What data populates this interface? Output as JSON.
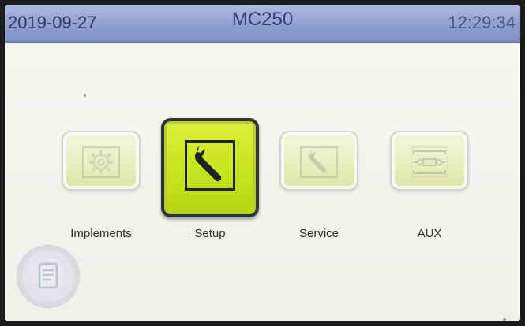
{
  "status_bar": {
    "date": "2019-09-27",
    "title": "MC250",
    "time": "12:29:34"
  },
  "menu": {
    "items": [
      {
        "label": "Implements",
        "icon": "gear-icon",
        "state": "disabled"
      },
      {
        "label": "Setup",
        "icon": "wrench-icon",
        "state": "selected"
      },
      {
        "label": "Service",
        "icon": "wrench-icon",
        "state": "disabled"
      },
      {
        "label": "AUX",
        "icon": "valve-schematic-icon",
        "state": "disabled"
      }
    ]
  },
  "back_button": {
    "icon": "document-icon"
  },
  "colors": {
    "status_bar": "#8f9fcf",
    "selected_tile": "#c6e41f",
    "disabled_tile": "#e4ecad",
    "screen_bg": "#f1f1ee"
  }
}
